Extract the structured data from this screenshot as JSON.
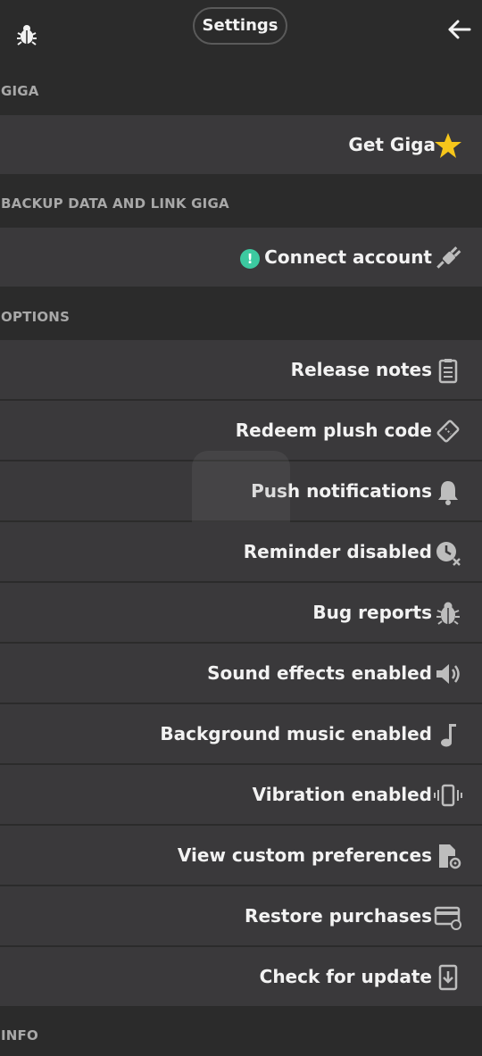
{
  "header": {
    "title": "Settings",
    "bug_icon": "bug-icon",
    "back_icon": "arrow-left-icon"
  },
  "sections": {
    "giga": "GIGA",
    "backup": "BACKUP DATA AND LINK GIGA",
    "options": "OPTIONS",
    "info": "INFO"
  },
  "rows": {
    "get_giga": {
      "label": "Get Giga",
      "icon": "star-icon"
    },
    "connect_account": {
      "label": "Connect account",
      "icon": "plug-icon",
      "alert": "!"
    },
    "release_notes": {
      "label": "Release notes",
      "icon": "clipboard-icon"
    },
    "redeem_plush": {
      "label": "Redeem plush code",
      "icon": "ticket-icon"
    },
    "push_notifications": {
      "label": "Push notifications",
      "icon": "bell-icon"
    },
    "reminder": {
      "label": "Reminder disabled",
      "icon": "clock-off-icon"
    },
    "bug_reports": {
      "label": "Bug reports",
      "icon": "bug-icon"
    },
    "sound_effects": {
      "label": "Sound effects enabled",
      "icon": "speaker-icon"
    },
    "background_music": {
      "label": "Background music enabled",
      "icon": "music-note-icon"
    },
    "vibration": {
      "label": "Vibration enabled",
      "icon": "vibration-icon"
    },
    "custom_prefs": {
      "label": "View custom preferences",
      "icon": "file-gear-icon"
    },
    "restore_purchases": {
      "label": "Restore purchases",
      "icon": "card-refresh-icon"
    },
    "check_update": {
      "label": "Check for update",
      "icon": "download-icon"
    }
  },
  "colors": {
    "background": "#2b2b2b",
    "row": "#3a393b",
    "star": "#f6c61b",
    "alert": "#3cc9a0",
    "icon": "#bdbdbd"
  }
}
